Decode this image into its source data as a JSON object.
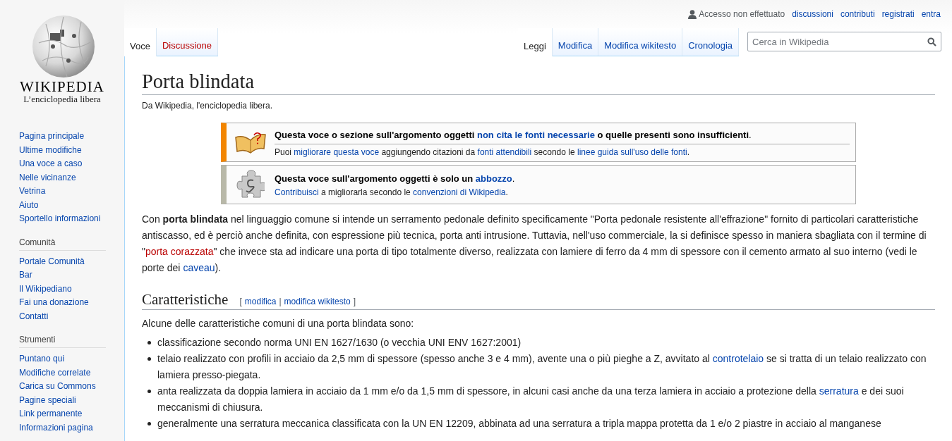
{
  "logo": {
    "wordmark": "WIKIPEDIA",
    "tagline": "L’enciclopedia libera"
  },
  "sidebar": [
    {
      "items": [
        "Pagina principale",
        "Ultime modifiche",
        "Una voce a caso",
        "Nelle vicinanze",
        "Vetrina",
        "Aiuto",
        "Sportello informazioni"
      ]
    },
    {
      "heading": "Comunità",
      "items": [
        "Portale Comunità",
        "Bar",
        "Il Wikipediano",
        "Fai una donazione",
        "Contatti"
      ]
    },
    {
      "heading": "Strumenti",
      "items": [
        "Puntano qui",
        "Modifiche correlate",
        "Carica su Commons",
        "Pagine speciali",
        "Link permanente",
        "Informazioni pagina"
      ]
    }
  ],
  "personal": {
    "status": "Accesso non effettuato",
    "links": [
      "discussioni",
      "contributi",
      "registrati",
      "entra"
    ]
  },
  "namespace_tabs": [
    {
      "label": "Voce",
      "selected": true,
      "missing": false
    },
    {
      "label": "Discussione",
      "selected": false,
      "missing": true
    }
  ],
  "view_tabs": [
    {
      "label": "Leggi",
      "selected": true
    },
    {
      "label": "Modifica",
      "selected": false
    },
    {
      "label": "Modifica wikitesto",
      "selected": false
    },
    {
      "label": "Cronologia",
      "selected": false
    }
  ],
  "search": {
    "placeholder": "Cerca in Wikipedia"
  },
  "article": {
    "title": "Porta blindata",
    "tagline": "Da Wikipedia, l'enciclopedia libera.",
    "notices": [
      {
        "kind": "sources",
        "title": [
          {
            "kind": "text",
            "text": "Questa voce o sezione sull'argomento oggetti "
          },
          {
            "kind": "link",
            "text": "non cita le fonti necessarie"
          },
          {
            "kind": "text",
            "text": " o quelle presenti sono insufficienti"
          }
        ],
        "title_end": ".",
        "body": [
          {
            "kind": "text",
            "text": "Puoi "
          },
          {
            "kind": "link",
            "text": "migliorare questa voce"
          },
          {
            "kind": "text",
            "text": " aggiungendo citazioni da "
          },
          {
            "kind": "link",
            "text": "fonti attendibili"
          },
          {
            "kind": "text",
            "text": " secondo le "
          },
          {
            "kind": "link",
            "text": "linee guida sull'uso delle fonti"
          },
          {
            "kind": "text",
            "text": "."
          }
        ]
      },
      {
        "kind": "stub",
        "title": [
          {
            "kind": "text",
            "text": "Questa voce sull'argomento oggetti è solo un "
          },
          {
            "kind": "link",
            "text": "abbozzo"
          }
        ],
        "title_end": ".",
        "body": [
          {
            "kind": "link",
            "text": "Contribuisci"
          },
          {
            "kind": "text",
            "text": " a migliorarla secondo le "
          },
          {
            "kind": "link",
            "text": "convenzioni di Wikipedia"
          },
          {
            "kind": "text",
            "text": "."
          }
        ]
      }
    ],
    "intro": [
      {
        "kind": "text",
        "text": "Con "
      },
      {
        "kind": "bold",
        "text": "porta blindata"
      },
      {
        "kind": "text",
        "text": " nel linguaggio comune si intende un serramento pedonale definito specificamente \"Porta pedonale resistente all'effrazione\" fornito di particolari caratteristiche antiscasso, ed è perciò anche definita, con espressione più tecnica, porta anti intrusione. Tuttavia, nell'uso commerciale, la si definisce spesso in maniera sbagliata con il termine di \""
      },
      {
        "kind": "redlink",
        "text": "porta corazzata"
      },
      {
        "kind": "text",
        "text": "\" che invece sta ad indicare una porta di tipo totalmente diverso, realizzata con lamiere di ferro da 4 mm di spessore con il cemento armato al suo interno (vedi le porte dei "
      },
      {
        "kind": "link",
        "text": "caveau"
      },
      {
        "kind": "text",
        "text": ")."
      }
    ],
    "section": {
      "title": "Caratteristiche",
      "edit_open": "[",
      "edit_links": [
        "modifica",
        "modifica wikitesto"
      ],
      "edit_separator": "|",
      "edit_close": "]",
      "lead": "Alcune delle caratteristiche comuni di una porta blindata sono:",
      "bullets": [
        [
          {
            "kind": "text",
            "text": "classificazione secondo norma UNI EN 1627/1630 (o vecchia UNI ENV 1627:2001)"
          }
        ],
        [
          {
            "kind": "text",
            "text": "telaio realizzato con profili in acciaio da 2,5 mm di spessore (spesso anche 3 e 4 mm), avente una o più pieghe a Z, avvitato al "
          },
          {
            "kind": "link",
            "text": "controtelaio"
          },
          {
            "kind": "text",
            "text": " se si tratta di un telaio realizzato con lamiera presso-piegata."
          }
        ],
        [
          {
            "kind": "text",
            "text": "anta realizzata da doppia lamiera in acciaio da 1 mm e/o da 1,5 mm di spessore, in alcuni casi anche da una terza lamiera in acciaio a protezione della "
          },
          {
            "kind": "link",
            "text": "serratura"
          },
          {
            "kind": "text",
            "text": " e dei suoi meccanismi di chiusura."
          }
        ],
        [
          {
            "kind": "text",
            "text": "generalmente una serratura meccanica classificata con la UN EN 12209, abbinata ad una serratura a tripla mappa protetta da 1 e/o 2 piastre in acciaio al manganese"
          }
        ]
      ]
    }
  }
}
